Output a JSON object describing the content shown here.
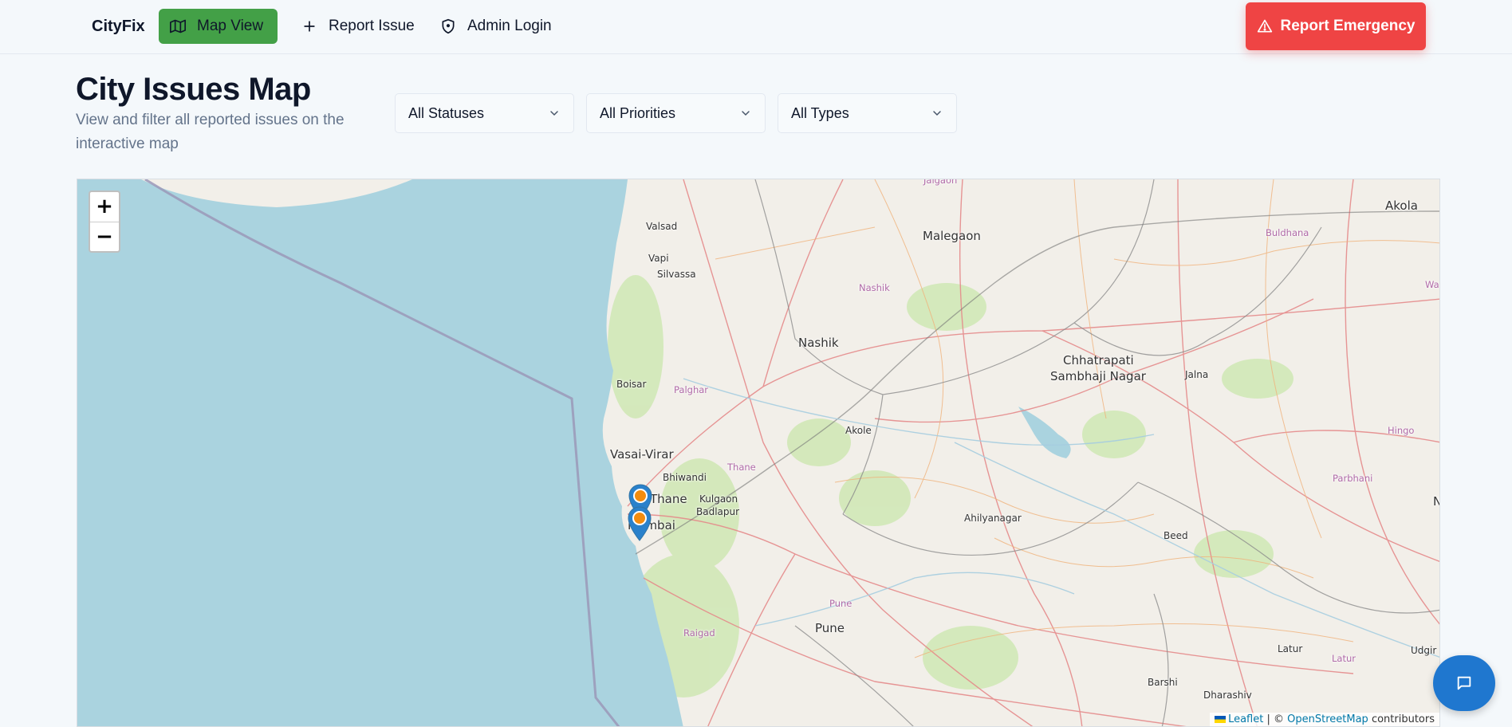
{
  "nav": {
    "brand": "CityFix",
    "map_view": "Map View",
    "report_issue": "Report Issue",
    "admin_login": "Admin Login",
    "emergency": "Report Emergency"
  },
  "header": {
    "title": "City Issues Map",
    "subtitle": "View and filter all reported issues on the interactive map"
  },
  "filters": {
    "status": "All Statuses",
    "priority": "All Priorities",
    "type": "All Types"
  },
  "map": {
    "labels": {
      "jalgaon": "Jalgaon",
      "akola": "Akola",
      "valsad": "Valsad",
      "malegaon": "Malegaon",
      "buldhana": "Buldhana",
      "vapi": "Vapi",
      "silvassa": "Silvassa",
      "nashik_district": "Nashik",
      "nashik": "Nashik",
      "chhatrapati": "Chhatrapati",
      "sambhaji_nagar": "Sambhaji Nagar",
      "jalna": "Jalna",
      "boisar": "Boisar",
      "palghar": "Palghar",
      "akole": "Akole",
      "vasai_virar": "Vasai-Virar",
      "thane_district": "Thane",
      "bhiwandi": "Bhiwandi",
      "thane": "Thane",
      "kulgaon": "Kulgaon",
      "badlapur": "Badlapur",
      "mumbai": "Mumbai",
      "ahilyanagar": "Ahilyanagar",
      "beed": "Beed",
      "parbhani": "Parbhani",
      "hingoli": "Hingo",
      "pune_district": "Pune",
      "pune": "Pune",
      "raigad": "Raigad",
      "latur": "Latur",
      "latur_district": "Latur",
      "udgir": "Udgir",
      "barshi": "Barshi",
      "dharashiv": "Dharashiv",
      "wa": "Wa",
      "n_edge": "N"
    },
    "zoom_in": "+",
    "zoom_out": "−",
    "attribution": {
      "leaflet": "Leaflet",
      "separator": "| ©",
      "osm": "OpenStreetMap",
      "contributors": "contributors"
    },
    "marker_color": "#2a81cb",
    "marker_dot_color": "#f28c0f"
  },
  "colors": {
    "primary_green": "#43a047",
    "emergency_red": "#ef4444",
    "chat_blue": "#1f77cf",
    "sea": "#aad3df"
  },
  "icons": {
    "map_view": "map-icon",
    "report_issue": "plus-icon",
    "admin_login": "shield-icon",
    "emergency": "alert-triangle-icon",
    "chat": "message-square-icon"
  }
}
